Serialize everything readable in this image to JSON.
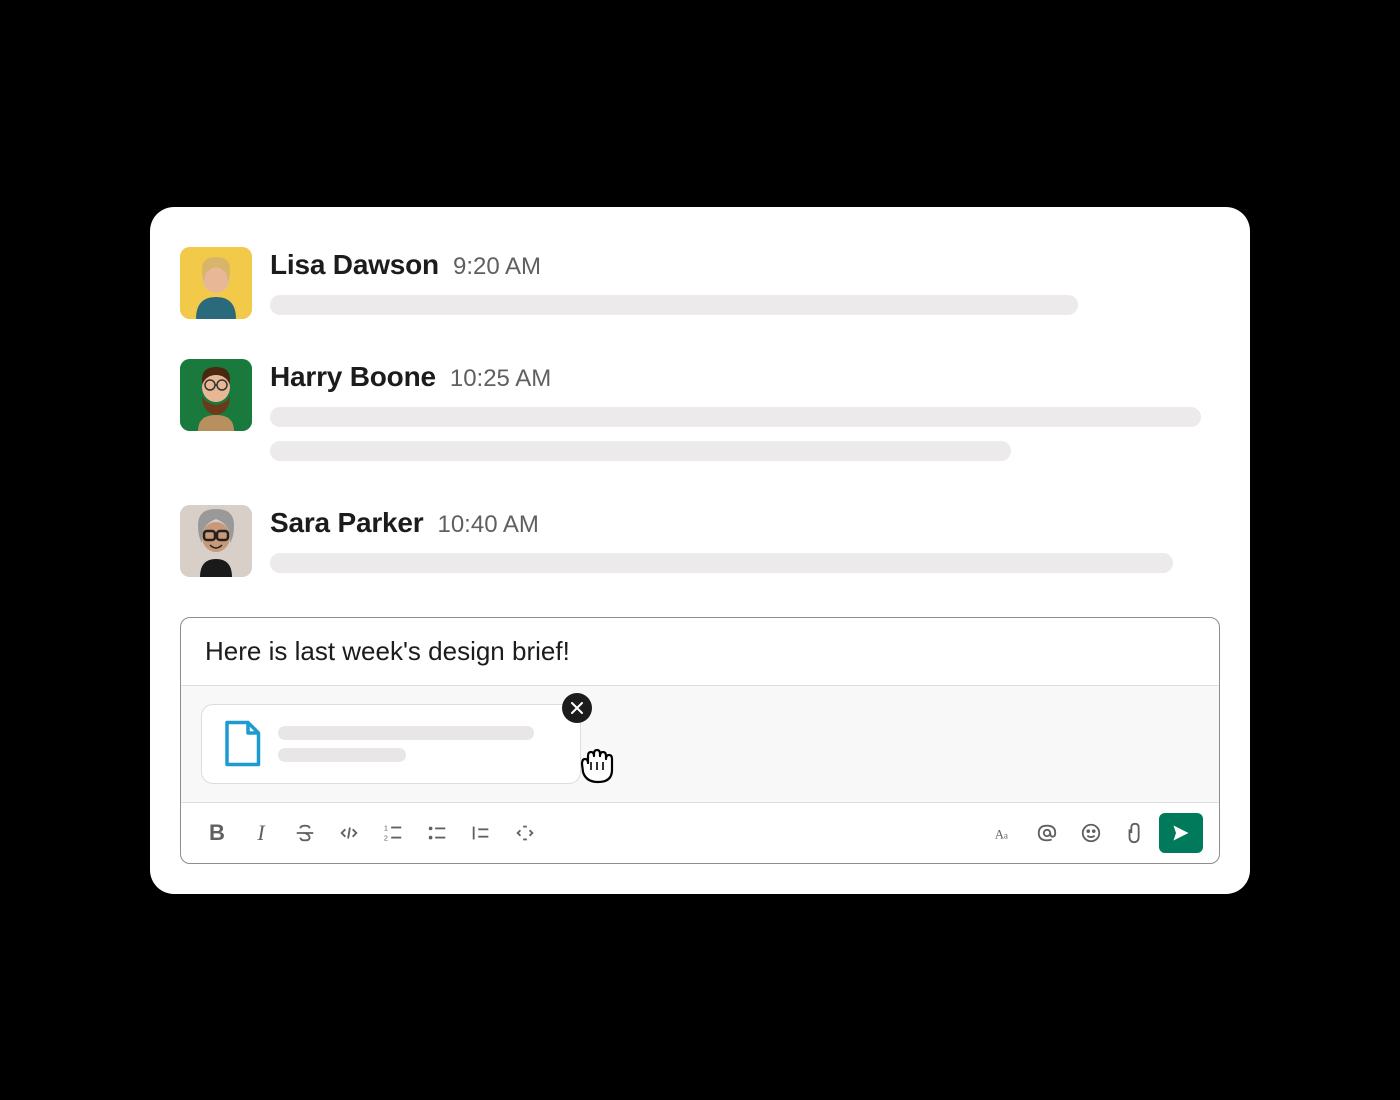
{
  "messages": [
    {
      "name": "Lisa Dawson",
      "time": "9:20 AM"
    },
    {
      "name": "Harry Boone",
      "time": "10:25 AM"
    },
    {
      "name": "Sara Parker",
      "time": "10:40 AM"
    }
  ],
  "composer": {
    "text": "Here is last week's design brief!"
  },
  "colors": {
    "send_button": "#007a5a",
    "file_icon": "#1d9bd1"
  }
}
